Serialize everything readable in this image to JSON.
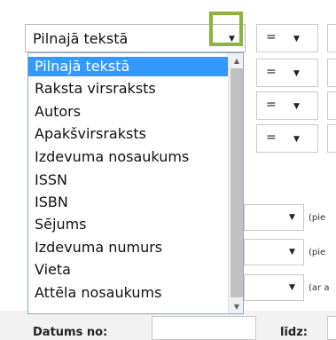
{
  "field_select": {
    "selected": "Pilnajā tekstā",
    "arrow": "▼"
  },
  "operators": [
    {
      "value": "=",
      "arrow": "▼"
    },
    {
      "value": "=",
      "arrow": "▼"
    },
    {
      "value": "=",
      "arrow": "▼"
    },
    {
      "value": "=",
      "arrow": "▼"
    }
  ],
  "dropdown": {
    "options": [
      "Pilnajā tekstā",
      "Raksta virsraksts",
      "Autors",
      "Apakšvirsraksts",
      "Izdevuma nosaukums",
      "ISSN",
      "ISBN",
      "Sējums",
      "Izdevuma numurs",
      "Vieta",
      "Attēla nosaukums"
    ],
    "selected_index": 0,
    "scroll_up": "▲",
    "scroll_down": "▼"
  },
  "right_selects": [
    {
      "arrow": "▼",
      "hint": "(pie"
    },
    {
      "arrow": "▼",
      "hint": "(pie"
    },
    {
      "arrow": "▼",
      "hint": "(ar a"
    }
  ],
  "date": {
    "from_label": "Datums no:",
    "to_label": "līdz:"
  },
  "colors": {
    "highlight": "#8cb43a",
    "selection": "#3399ff"
  }
}
